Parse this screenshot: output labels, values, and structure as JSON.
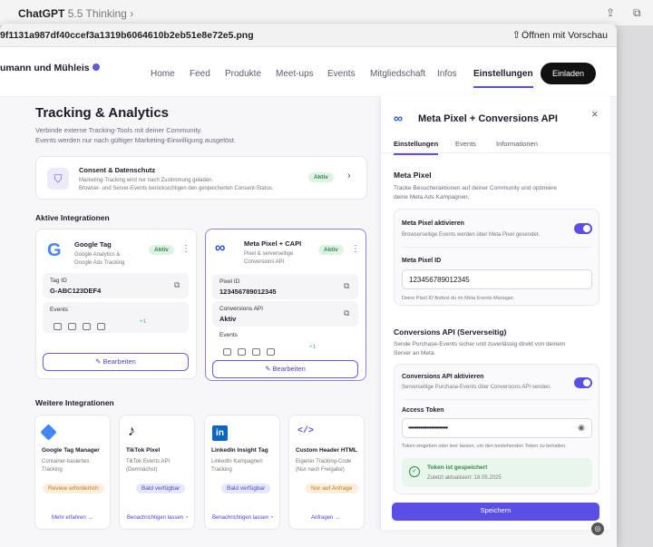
{
  "chatbar": {
    "app": "ChatGPT",
    "model": "5.5 Thinking",
    "chevron": "›"
  },
  "window": {
    "filename": "9f1131a987df40ccef3a1319b6064610b2eb51e8e72e5.png",
    "open_with": "Öffnen mit Vorschau"
  },
  "nav": {
    "brand": "umann und Mühleis",
    "links": [
      "Home",
      "Feed",
      "Produkte",
      "Meet-ups",
      "Events",
      "Mitgliedschaft",
      "Infos",
      "Einstellungen"
    ],
    "invite": "Einladen"
  },
  "page": {
    "title": "Tracking & Analytics",
    "subtitle1": "Verbinde externe Tracking-Tools mit deiner Community.",
    "subtitle2": "Events werden nur nach gültiger Marketing-Einwilligung ausgelöst.",
    "consent": {
      "title": "Consent & Datenschutz",
      "line1": "Marketing-Tracking wird nur nach Zustimmung geladen.",
      "line2": "Browser- und Server-Events berücksichtigen den gespeicherten Consent-Status.",
      "status": "Aktiv"
    },
    "active_heading": "Aktive Integrationen",
    "google_tag": {
      "name": "Google Tag",
      "desc1": "Google Analytics &",
      "desc2": "Google Ads Tracking",
      "status": "Aktiv",
      "id_label": "Tag ID",
      "id_value": "G-ABC123DEF4",
      "events_label": "Events",
      "more": "+1",
      "edit": "Bearbeiten"
    },
    "meta_card": {
      "name": "Meta Pixel + CAPI",
      "desc1": "Pixel & serverseitige",
      "desc2": "Conversions API",
      "status": "Aktiv",
      "pixel_label": "Pixel ID",
      "pixel_value": "123456789012345",
      "capi_label": "Conversions API",
      "capi_value": "Aktiv",
      "events_label": "Events",
      "more": "+1",
      "edit": "Bearbeiten"
    },
    "more_heading": "Weitere Integrationen",
    "more": [
      {
        "name": "Google Tag Manager",
        "d1": "Container-basiertes",
        "d2": "Tracking",
        "badge": "Review erforderlich",
        "link": "Mehr erfahren",
        "color": "#c07718"
      },
      {
        "name": "TikTok Pixel",
        "d1": "TikTok Events API",
        "d2": "(Demnächst)",
        "badge": "Bald verfügbar",
        "link": "Benachrichtigen lassen",
        "color": "#4a48c8"
      },
      {
        "name": "LinkedIn Insight Tag",
        "d1": "LinkedIn Kampagnen",
        "d2": "Tracking",
        "badge": "Bald verfügbar",
        "link": "Benachrichtigen lassen",
        "color": "#4a48c8"
      },
      {
        "name": "Custom Header HTML",
        "d1": "Eigener Tracking-Code",
        "d2": "(Nur nach Freigabe)",
        "badge": "Nur auf Anfrage",
        "link": "Anfragen",
        "color": "#c07718"
      }
    ]
  },
  "drawer": {
    "title": "Meta Pixel + Conversions API",
    "tabs": [
      "Einstellungen",
      "Events",
      "Informationen"
    ],
    "pixel_heading": "Meta Pixel",
    "pixel_desc1": "Tracke Besucheraktionen auf deiner Community und optimiere",
    "pixel_desc2": "deine Meta Ads Kampagnen.",
    "pixel_toggle_label": "Meta Pixel aktivieren",
    "pixel_toggle_sub": "Browserseitige Events werden über Meta Pixel gesendet.",
    "pixel_id_label": "Meta Pixel ID",
    "pixel_id_value": "123456789012345",
    "pixel_id_hint": "Deine Pixel ID findest du im Meta Events Manager.",
    "capi_heading": "Conversions API (Serverseitig)",
    "capi_desc1": "Sende Purchase-Events sicher und zuverlässig direkt von deinem",
    "capi_desc2": "Server an Meta.",
    "capi_toggle_label": "Conversions API aktivieren",
    "capi_toggle_sub": "Serverseitige Purchase-Events über Conversions API senden.",
    "token_label": "Access Token",
    "token_value": "••••••••••••••••••••••••",
    "token_hint": "Token eingeben oder leer lassen, um den bestehenden Token zu behalten.",
    "saved_title": "Token ist gespeichert",
    "saved_sub": "Zuletzt aktualisiert: 18.05.2025",
    "save": "Speichern"
  }
}
